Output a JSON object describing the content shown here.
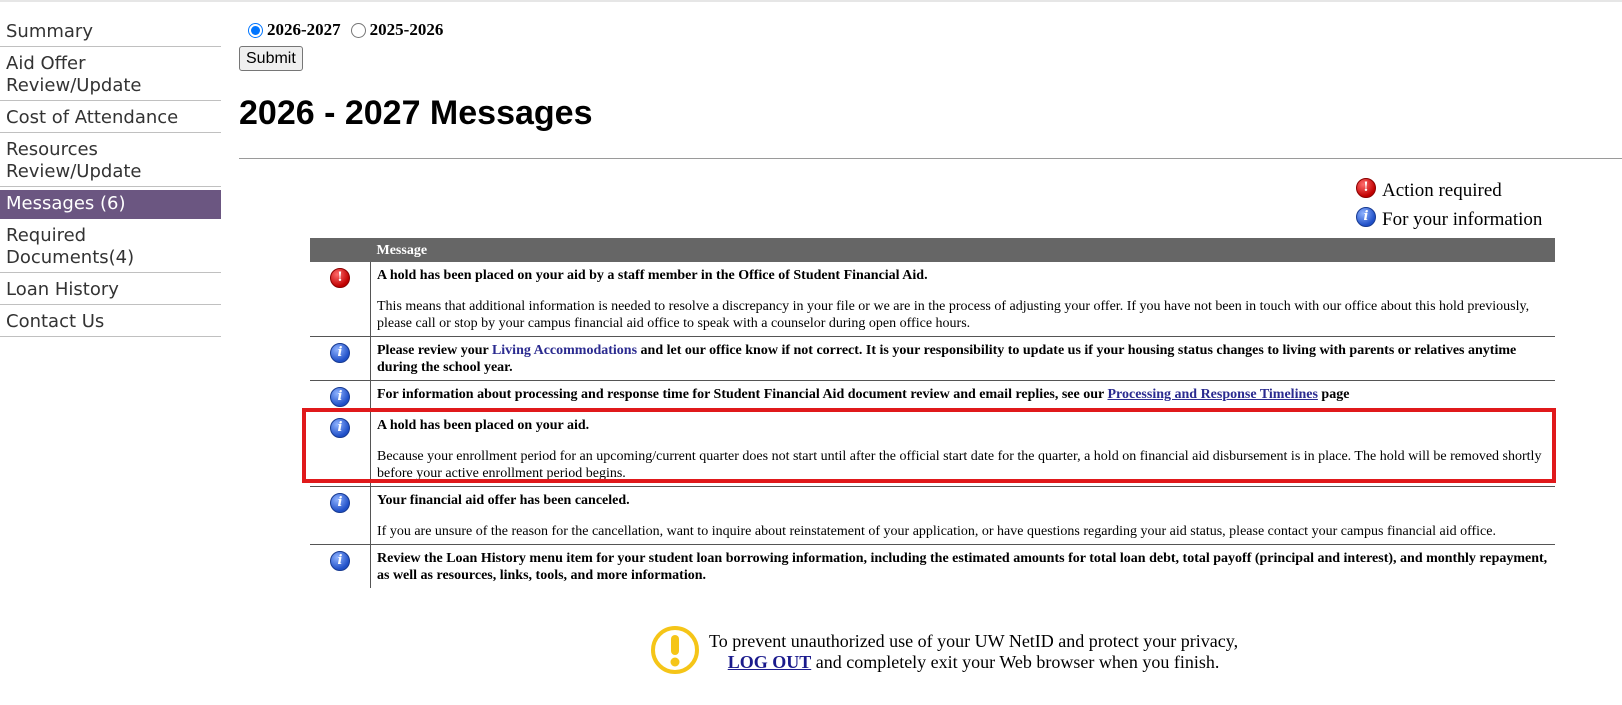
{
  "sidebar": {
    "items": [
      {
        "label": "Summary"
      },
      {
        "label": "Aid Offer Review/Update"
      },
      {
        "label": "Cost of Attendance"
      },
      {
        "label": "Resources Review/Update"
      },
      {
        "label": "Messages (6)"
      },
      {
        "label": "Required Documents(4)"
      },
      {
        "label": "Loan History"
      },
      {
        "label": "Contact Us"
      }
    ],
    "active_index": 4
  },
  "year_form": {
    "options": [
      {
        "label": "2026-2027",
        "checked": true
      },
      {
        "label": "2025-2026",
        "checked": false
      }
    ],
    "submit_label": "Submit"
  },
  "page_title": "2026 - 2027 Messages",
  "legend": {
    "action_required": "Action required",
    "for_info": "For your information"
  },
  "table": {
    "header_message": "Message",
    "rows": [
      {
        "icon": "action-required-icon",
        "subject": "A hold has been placed on your aid by a staff member in the Office of Student Financial Aid.",
        "body": "This means that additional information is needed to resolve a discrepancy in your file or we are in the process of adjusting your offer. If you have not been in touch with our office about this hold previously, please call or stop by your campus financial aid office to speak with a counselor during open office hours."
      },
      {
        "icon": "info-icon",
        "subject_pre": "Please review your ",
        "link": "Living Accommodations",
        "subject_post": " and let our office know if not correct. It is your responsibility to update us if your housing status changes to living with parents or relatives anytime during the school year."
      },
      {
        "icon": "info-icon",
        "subject_pre": "For information about processing and response time for Student Financial Aid document review and email replies, see our ",
        "link": "Processing and Response Timelines",
        "subject_post": " page"
      },
      {
        "icon": "info-icon",
        "subject": "A hold has been placed on your aid.",
        "body": "Because your enrollment period for an upcoming/current quarter does not start until after the official start date for the quarter, a hold on financial aid disbursement is in place. The hold will be removed shortly before your active enrollment period begins."
      },
      {
        "icon": "info-icon",
        "subject": "Your financial aid offer has been canceled.",
        "body": "If you are unsure of the reason for the cancellation, want to inquire about reinstatement of your application, or have questions regarding your aid status, please contact your campus financial aid office."
      },
      {
        "icon": "info-icon",
        "subject": "Review the Loan History menu item for your student loan borrowing information, including the estimated amounts for total loan debt, total payoff (principal and interest), and monthly repayment, as well as resources, links, tools, and more information."
      }
    ]
  },
  "footer": {
    "line1": "To prevent unauthorized use of your UW NetID and protect your privacy,",
    "logout": "LOG OUT",
    "line2_post": " and completely exit your Web browser when you finish."
  },
  "colors": {
    "active_nav": "#6b5681",
    "table_header": "#666666",
    "highlight": "#e0191b",
    "link": "#2a2a8f"
  }
}
